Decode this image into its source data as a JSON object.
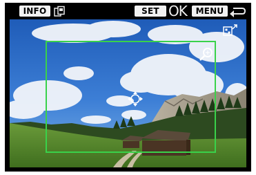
{
  "topbar": {
    "info_label": "INFO",
    "set_label": "SET",
    "ok_label": "OK",
    "menu_label": "MENU",
    "copy_icon": "copy-icon",
    "return_icon": "return-arrow-icon"
  },
  "overlay": {
    "crop_frame_color": "#39d24a",
    "magnify_icon": "magnify-icon",
    "aspect_icon": "aspect-ratio-icon",
    "move_icon": "move-arrows-icon"
  }
}
